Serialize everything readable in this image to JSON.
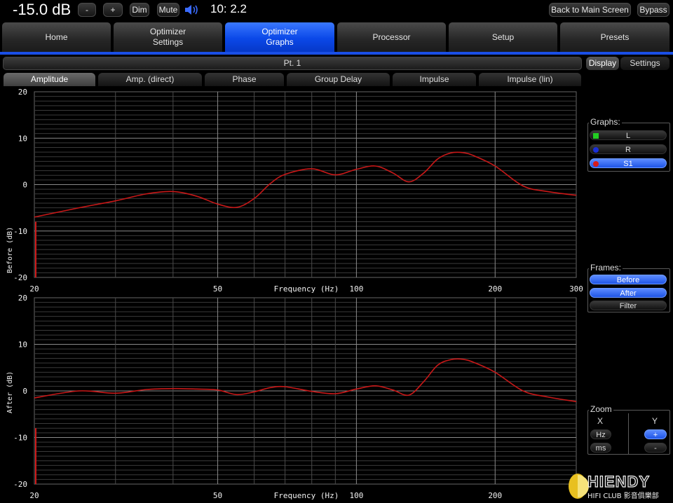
{
  "topbar": {
    "volume": "-15.0 dB",
    "minus_label": "-",
    "plus_label": "+",
    "dim_label": "Dim",
    "mute_label": "Mute",
    "speaker_icon": "speaker-volume-icon",
    "time": "10: 2.2",
    "back_label": "Back to Main Screen",
    "bypass_label": "Bypass"
  },
  "main_tabs": [
    {
      "label": "Home"
    },
    {
      "label": "Optimizer\nSettings"
    },
    {
      "label": "Optimizer\nGraphs"
    },
    {
      "label": "Processor"
    },
    {
      "label": "Setup"
    },
    {
      "label": "Presets"
    }
  ],
  "active_main_tab": "Optimizer Graphs",
  "point_title": "Pt. 1",
  "graph_tabs": [
    {
      "label": "Amplitude"
    },
    {
      "label": "Amp. (direct)"
    },
    {
      "label": "Phase"
    },
    {
      "label": "Group Delay"
    },
    {
      "label": "Impulse"
    },
    {
      "label": "Impulse (lin)"
    }
  ],
  "active_graph_tab": "Amplitude",
  "side_tabs": {
    "display": "Display",
    "settings": "Settings"
  },
  "graphs_group": {
    "title": "Graphs:",
    "items": [
      {
        "label": "L",
        "dot_color": "#22cc22",
        "active": false
      },
      {
        "label": "R",
        "dot_color": "#1a2fd8",
        "active": false
      },
      {
        "label": "S1",
        "dot_color": "#d81a1a",
        "active": true
      }
    ]
  },
  "frames_group": {
    "title": "Frames:",
    "items": [
      {
        "label": "Before",
        "active": true
      },
      {
        "label": "After",
        "active": true
      },
      {
        "label": "Filter",
        "active": false
      }
    ]
  },
  "zoom_group": {
    "title": "Zoom",
    "x_label": "X",
    "y_label": "Y",
    "hz_label": "Hz",
    "ms_label": "ms",
    "plus_label": "+",
    "minus_label": "-"
  },
  "watermark": {
    "logo_text": "HIENDY",
    "sub_text": "HIFI CLUB 影音俱樂部"
  },
  "colors": {
    "accent_blue": "#1a4fe6",
    "curve_red": "#c81818",
    "grid": "#3c3c3c"
  },
  "chart_data": [
    {
      "type": "line",
      "title": "",
      "ylabel": "Before (dB)",
      "xlabel": "Frequency (Hz)",
      "x_scale": "log",
      "xlim": [
        20,
        300
      ],
      "ylim": [
        -20,
        20
      ],
      "x_tick_labels": [
        "20",
        "50",
        "100",
        "200",
        "300"
      ],
      "y_tick_labels": [
        "20",
        "10",
        "0",
        "-10",
        "-20"
      ],
      "grid": true,
      "series": [
        {
          "color": "#c81818",
          "x": [
            20,
            25,
            30,
            35,
            40,
            45,
            50,
            55,
            60,
            65,
            70,
            80,
            90,
            100,
            110,
            120,
            130,
            140,
            150,
            160,
            170,
            180,
            200,
            230,
            260,
            300
          ],
          "y": [
            -7.0,
            -5.0,
            -3.5,
            -2.0,
            -1.5,
            -2.5,
            -4.2,
            -4.9,
            -3.0,
            0.2,
            2.2,
            3.4,
            2.1,
            3.3,
            4.0,
            2.5,
            0.6,
            2.5,
            5.5,
            6.8,
            6.9,
            6.2,
            4.0,
            -0.3,
            -1.5,
            -2.3
          ]
        }
      ]
    },
    {
      "type": "line",
      "title": "",
      "ylabel": "After (dB)",
      "xlabel": "Frequency (Hz)",
      "x_scale": "log",
      "xlim": [
        20,
        300
      ],
      "ylim": [
        -20,
        20
      ],
      "x_tick_labels": [
        "20",
        "50",
        "100",
        "200"
      ],
      "y_tick_labels": [
        "20",
        "10",
        "0",
        "-10",
        "-20"
      ],
      "grid": true,
      "series": [
        {
          "color": "#c81818",
          "x": [
            20,
            25,
            30,
            35,
            40,
            45,
            50,
            55,
            60,
            65,
            70,
            80,
            90,
            100,
            110,
            120,
            130,
            140,
            150,
            160,
            170,
            180,
            200,
            230,
            260,
            300
          ],
          "y": [
            -1.5,
            0.0,
            -0.5,
            0.3,
            0.5,
            0.4,
            0.2,
            -0.8,
            -0.2,
            0.7,
            0.9,
            -0.1,
            -0.6,
            0.4,
            1.1,
            0.2,
            -0.9,
            2.0,
            5.5,
            6.7,
            6.8,
            6.1,
            4.0,
            0.0,
            -1.3,
            -2.3
          ]
        }
      ]
    }
  ]
}
